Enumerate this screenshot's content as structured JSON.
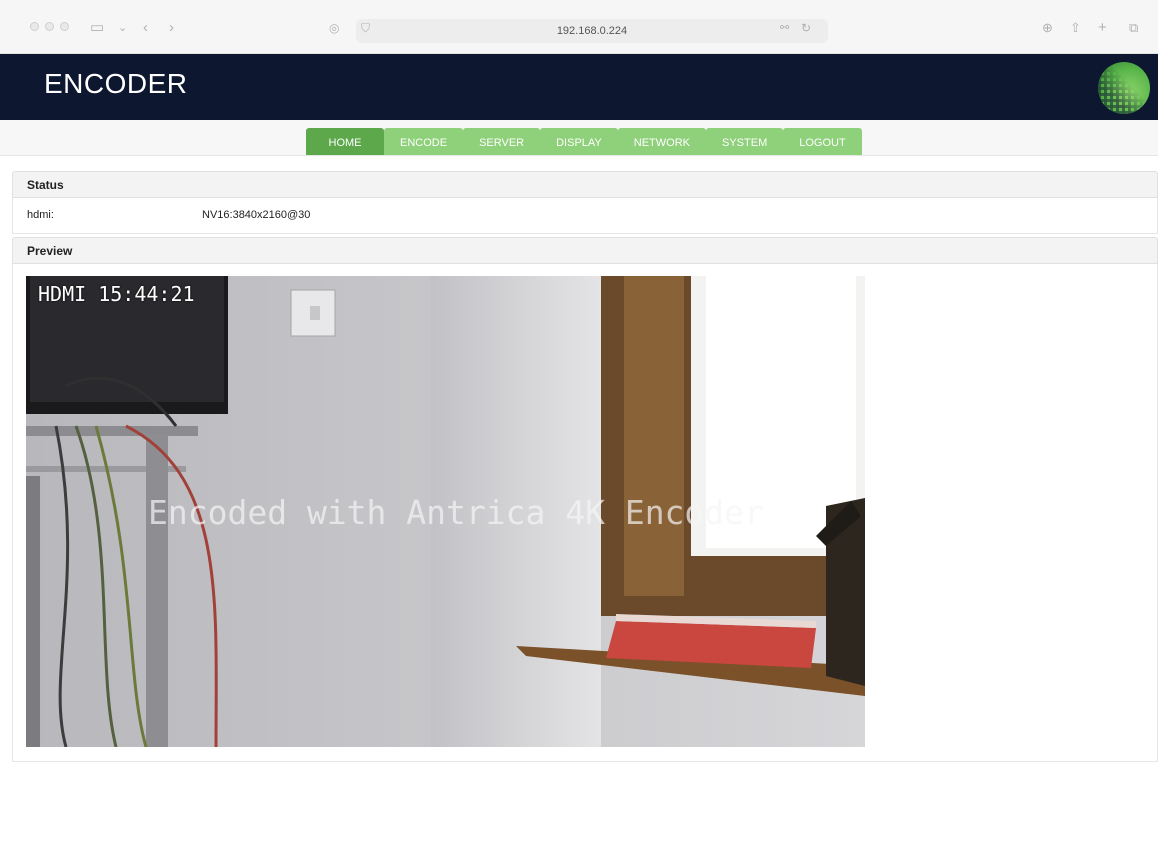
{
  "browser": {
    "address": "192.168.0.224"
  },
  "header": {
    "title": "ENCODER"
  },
  "nav": {
    "items": [
      {
        "label": "HOME",
        "active": true
      },
      {
        "label": "ENCODE"
      },
      {
        "label": "SERVER"
      },
      {
        "label": "DISPLAY"
      },
      {
        "label": "NETWORK"
      },
      {
        "label": "SYSTEM"
      },
      {
        "label": "LOGOUT"
      }
    ]
  },
  "status": {
    "title": "Status",
    "rows": [
      {
        "key": "hdmi:",
        "value": "NV16:3840x2160@30"
      }
    ]
  },
  "preview": {
    "title": "Preview",
    "osd": "HDMI 15:44:21",
    "watermark": "Encoded with Antrica 4K Encoder"
  },
  "colors": {
    "header_bg": "#0d1730",
    "nav_active": "#5ca84a",
    "nav_inactive": "#8fd07a"
  }
}
